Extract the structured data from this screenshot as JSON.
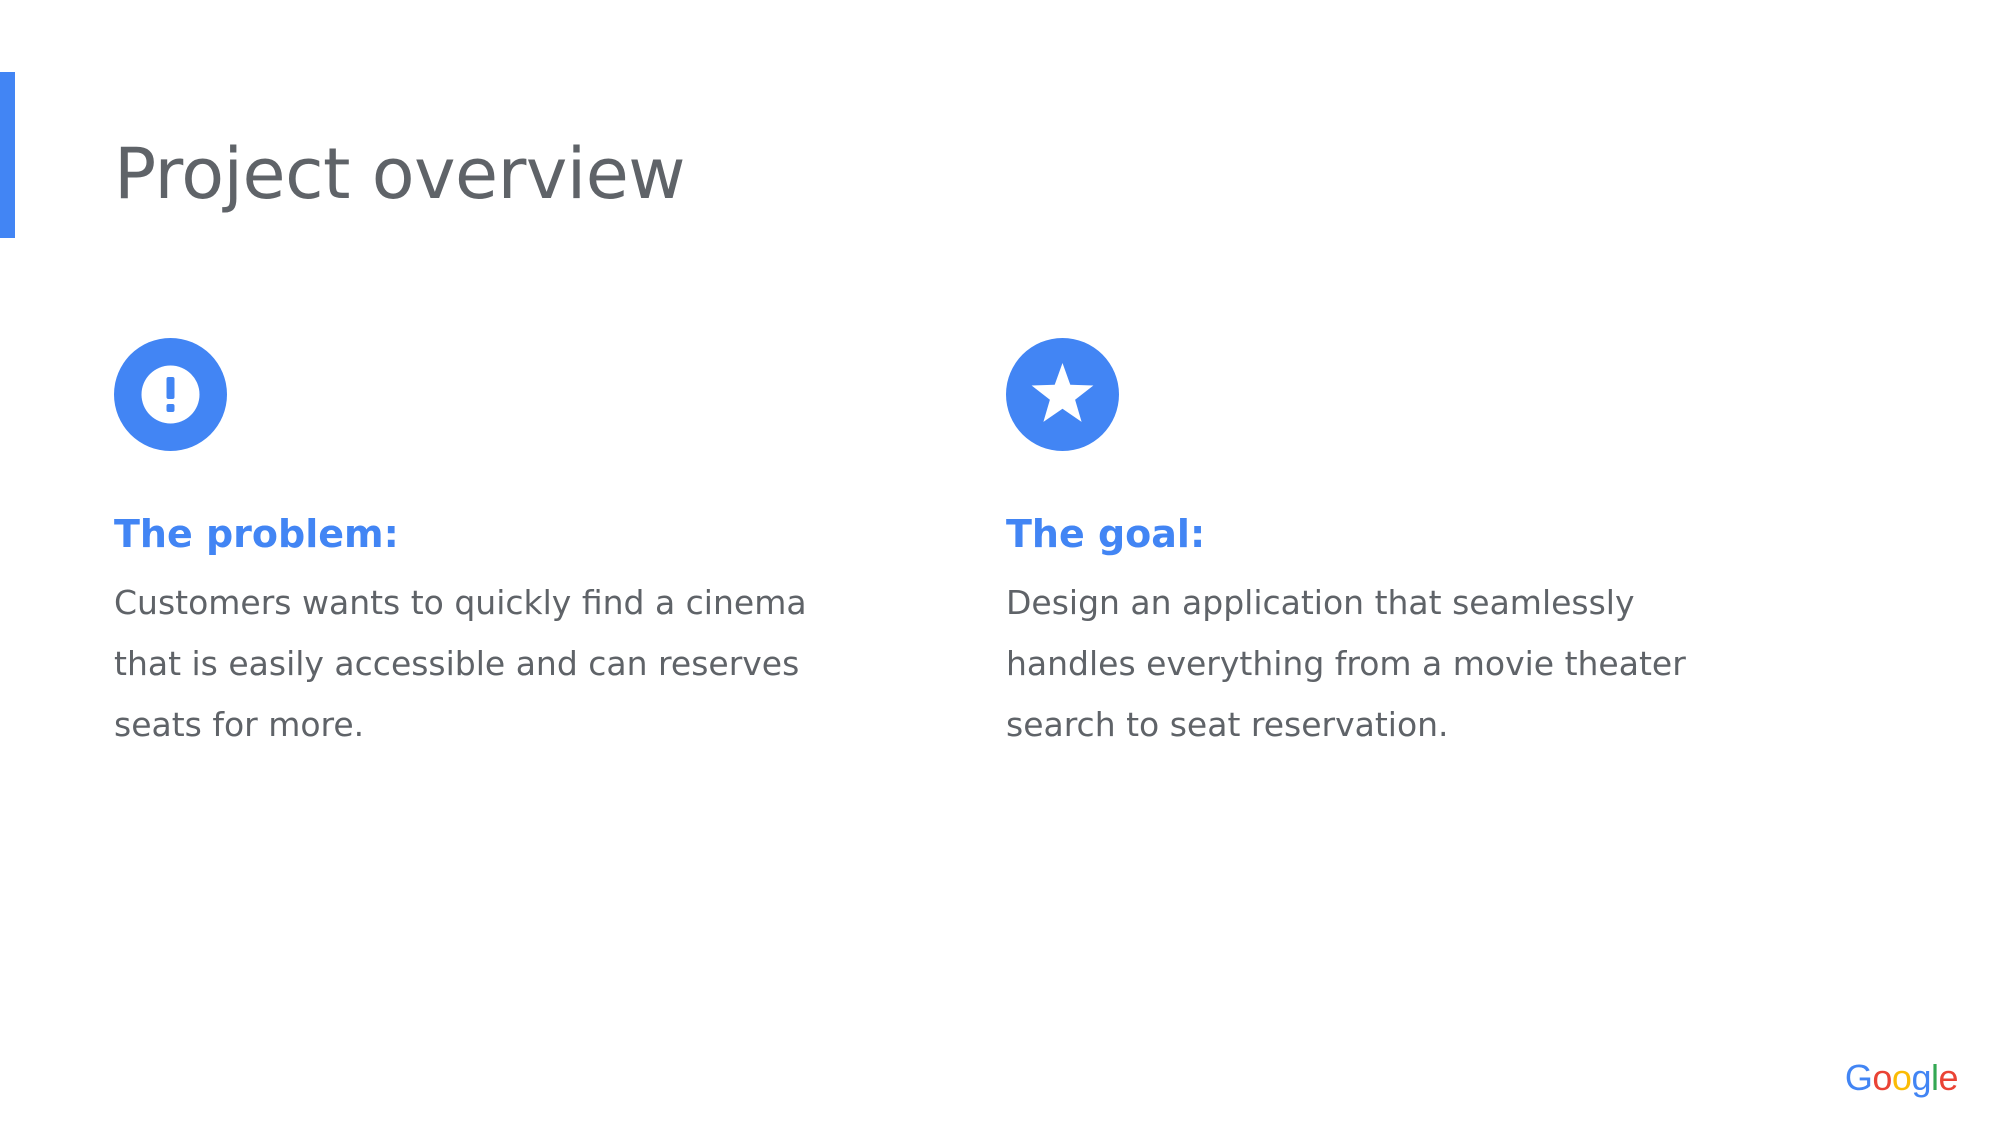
{
  "slide": {
    "title": "Project overview",
    "accent_color": "#4285f4",
    "text_color": "#5f6368"
  },
  "problem": {
    "icon": "exclamation-circle-icon",
    "heading": "The problem:",
    "body": "Customers wants to quickly find a cinema that is easily accessible and can reserves seats for more."
  },
  "goal": {
    "icon": "star-circle-icon",
    "heading": "The goal:",
    "body": "Design an application that seamlessly handles everything from a movie theater search to seat reservation."
  },
  "logo": {
    "letters": [
      "G",
      "o",
      "o",
      "g",
      "l",
      "e"
    ],
    "colors": [
      "#4285f4",
      "#ea4335",
      "#fbbc05",
      "#4285f4",
      "#34a853",
      "#ea4335"
    ]
  }
}
